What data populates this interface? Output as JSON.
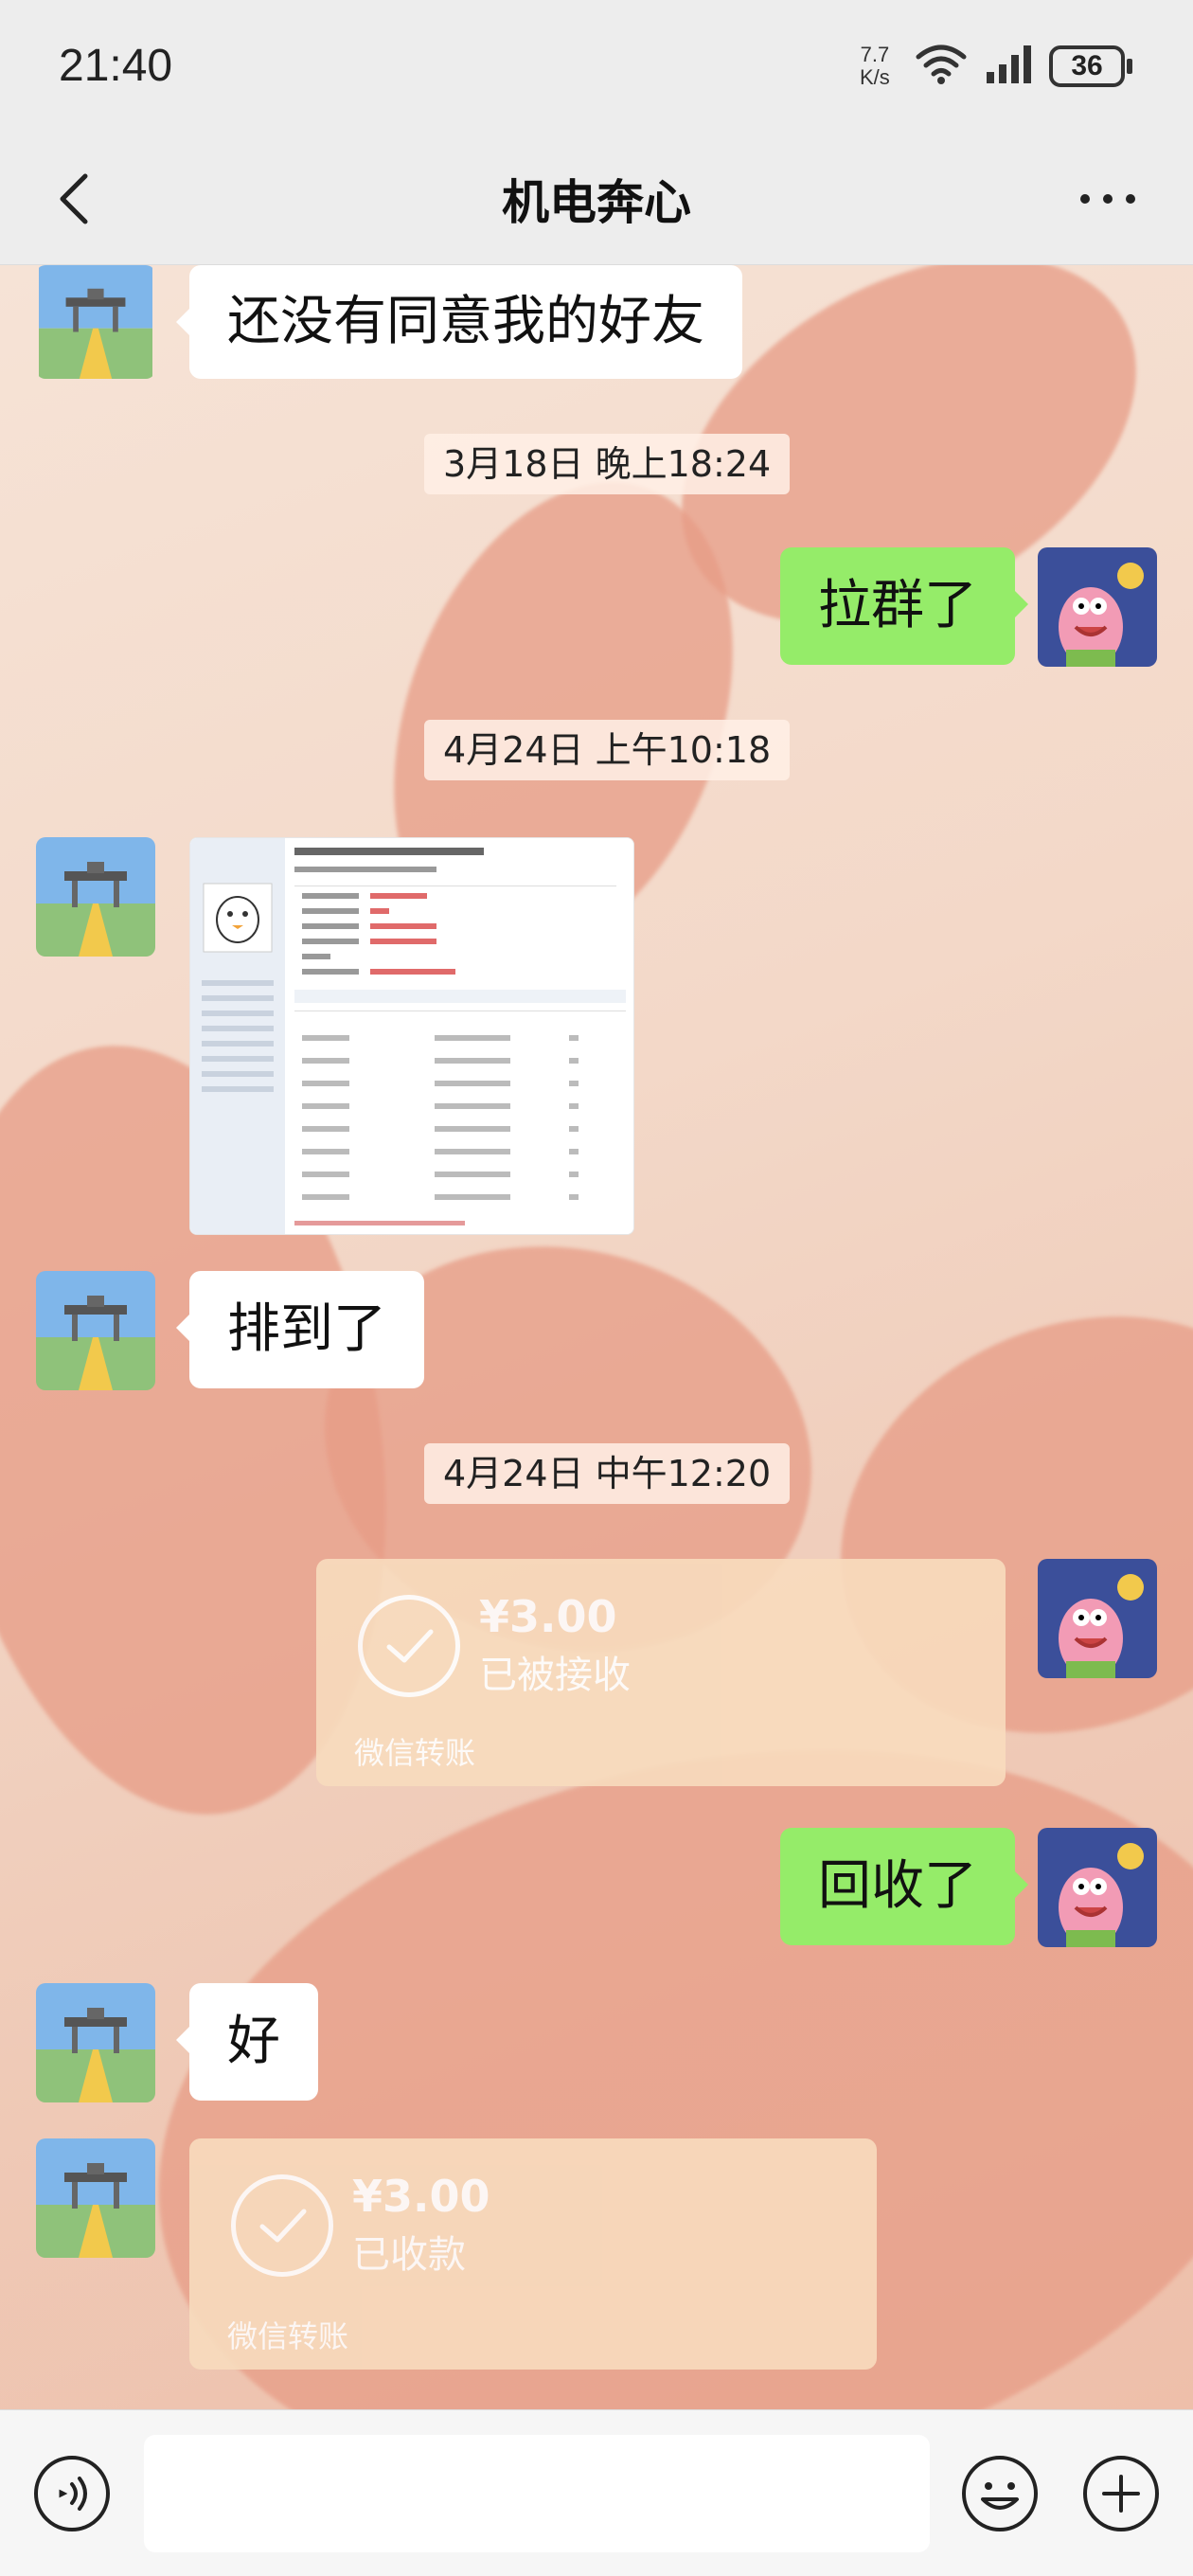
{
  "status_bar": {
    "time": "21:40",
    "net_speed_value": "7.7",
    "net_speed_unit": "K/s",
    "battery": "36"
  },
  "header": {
    "title": "机电奔心",
    "back_icon": "chevron-left-icon",
    "more_icon": "more-horizontal-icon"
  },
  "messages": [
    {
      "type": "text",
      "side": "in",
      "text": "还没有同意我的好友"
    },
    {
      "type": "time",
      "text": "3月18日 晚上18:24"
    },
    {
      "type": "text",
      "side": "out",
      "text": "拉群了"
    },
    {
      "type": "time",
      "text": "4月24日 上午10:18"
    },
    {
      "type": "image",
      "side": "in"
    },
    {
      "type": "text",
      "side": "in",
      "text": "排到了"
    },
    {
      "type": "time",
      "text": "4月24日 中午12:20"
    },
    {
      "type": "transfer",
      "side": "out",
      "amount": "¥3.00",
      "status": "已被接收",
      "label": "微信转账"
    },
    {
      "type": "text",
      "side": "out",
      "text": "回收了"
    },
    {
      "type": "text",
      "side": "in",
      "text": "好"
    },
    {
      "type": "transfer",
      "side": "in",
      "amount": "¥3.00",
      "status": "已收款",
      "label": "微信转账"
    }
  ],
  "input_bar": {
    "voice_icon": "voice-icon",
    "emoji_icon": "emoji-icon",
    "plus_icon": "plus-icon"
  },
  "colors": {
    "outgoing_bubble": "#95ec69",
    "incoming_bubble": "#ffffff",
    "transfer_card": "#f8dcbe",
    "bars": "#ededed"
  }
}
